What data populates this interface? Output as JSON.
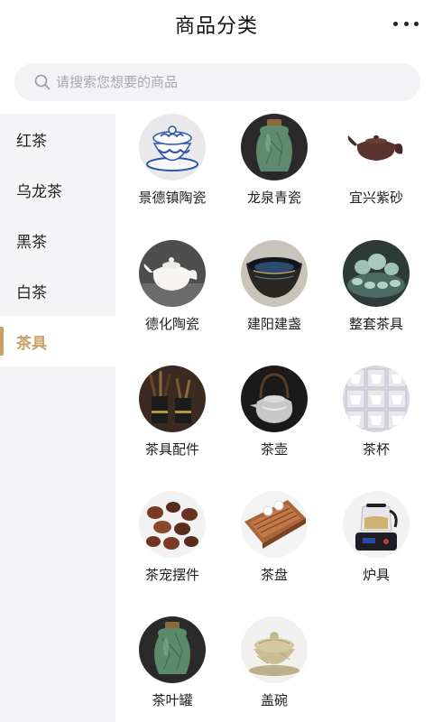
{
  "header": {
    "title": "商品分类",
    "more_icon": "more-dots-icon"
  },
  "search": {
    "placeholder": "请搜索您想要的商品",
    "icon": "search-icon"
  },
  "sidebar": {
    "active_color": "#c9a06a",
    "items": [
      {
        "label": "红茶",
        "active": false
      },
      {
        "label": "乌龙茶",
        "active": false
      },
      {
        "label": "黑茶",
        "active": false
      },
      {
        "label": "白茶",
        "active": false
      },
      {
        "label": "茶具",
        "active": true
      }
    ]
  },
  "products": [
    {
      "label": "景德镇陶瓷",
      "image": "blue-white-gaiwan"
    },
    {
      "label": "龙泉青瓷",
      "image": "celadon-jar"
    },
    {
      "label": "宜兴紫砂",
      "image": "zisha-teapot"
    },
    {
      "label": "德化陶瓷",
      "image": "white-porcelain-teapot"
    },
    {
      "label": "建阳建盏",
      "image": "jian-tea-bowl"
    },
    {
      "label": "整套茶具",
      "image": "tea-set"
    },
    {
      "label": "茶具配件",
      "image": "tea-utensils"
    },
    {
      "label": "茶壶",
      "image": "silver-kettle"
    },
    {
      "label": "茶杯",
      "image": "tea-cups"
    },
    {
      "label": "茶宠摆件",
      "image": "tea-pets"
    },
    {
      "label": "茶盘",
      "image": "tea-tray"
    },
    {
      "label": "炉具",
      "image": "electric-stove"
    },
    {
      "label": "茶叶罐",
      "image": "tea-caddy"
    },
    {
      "label": "盖碗",
      "image": "gaiwan"
    }
  ]
}
